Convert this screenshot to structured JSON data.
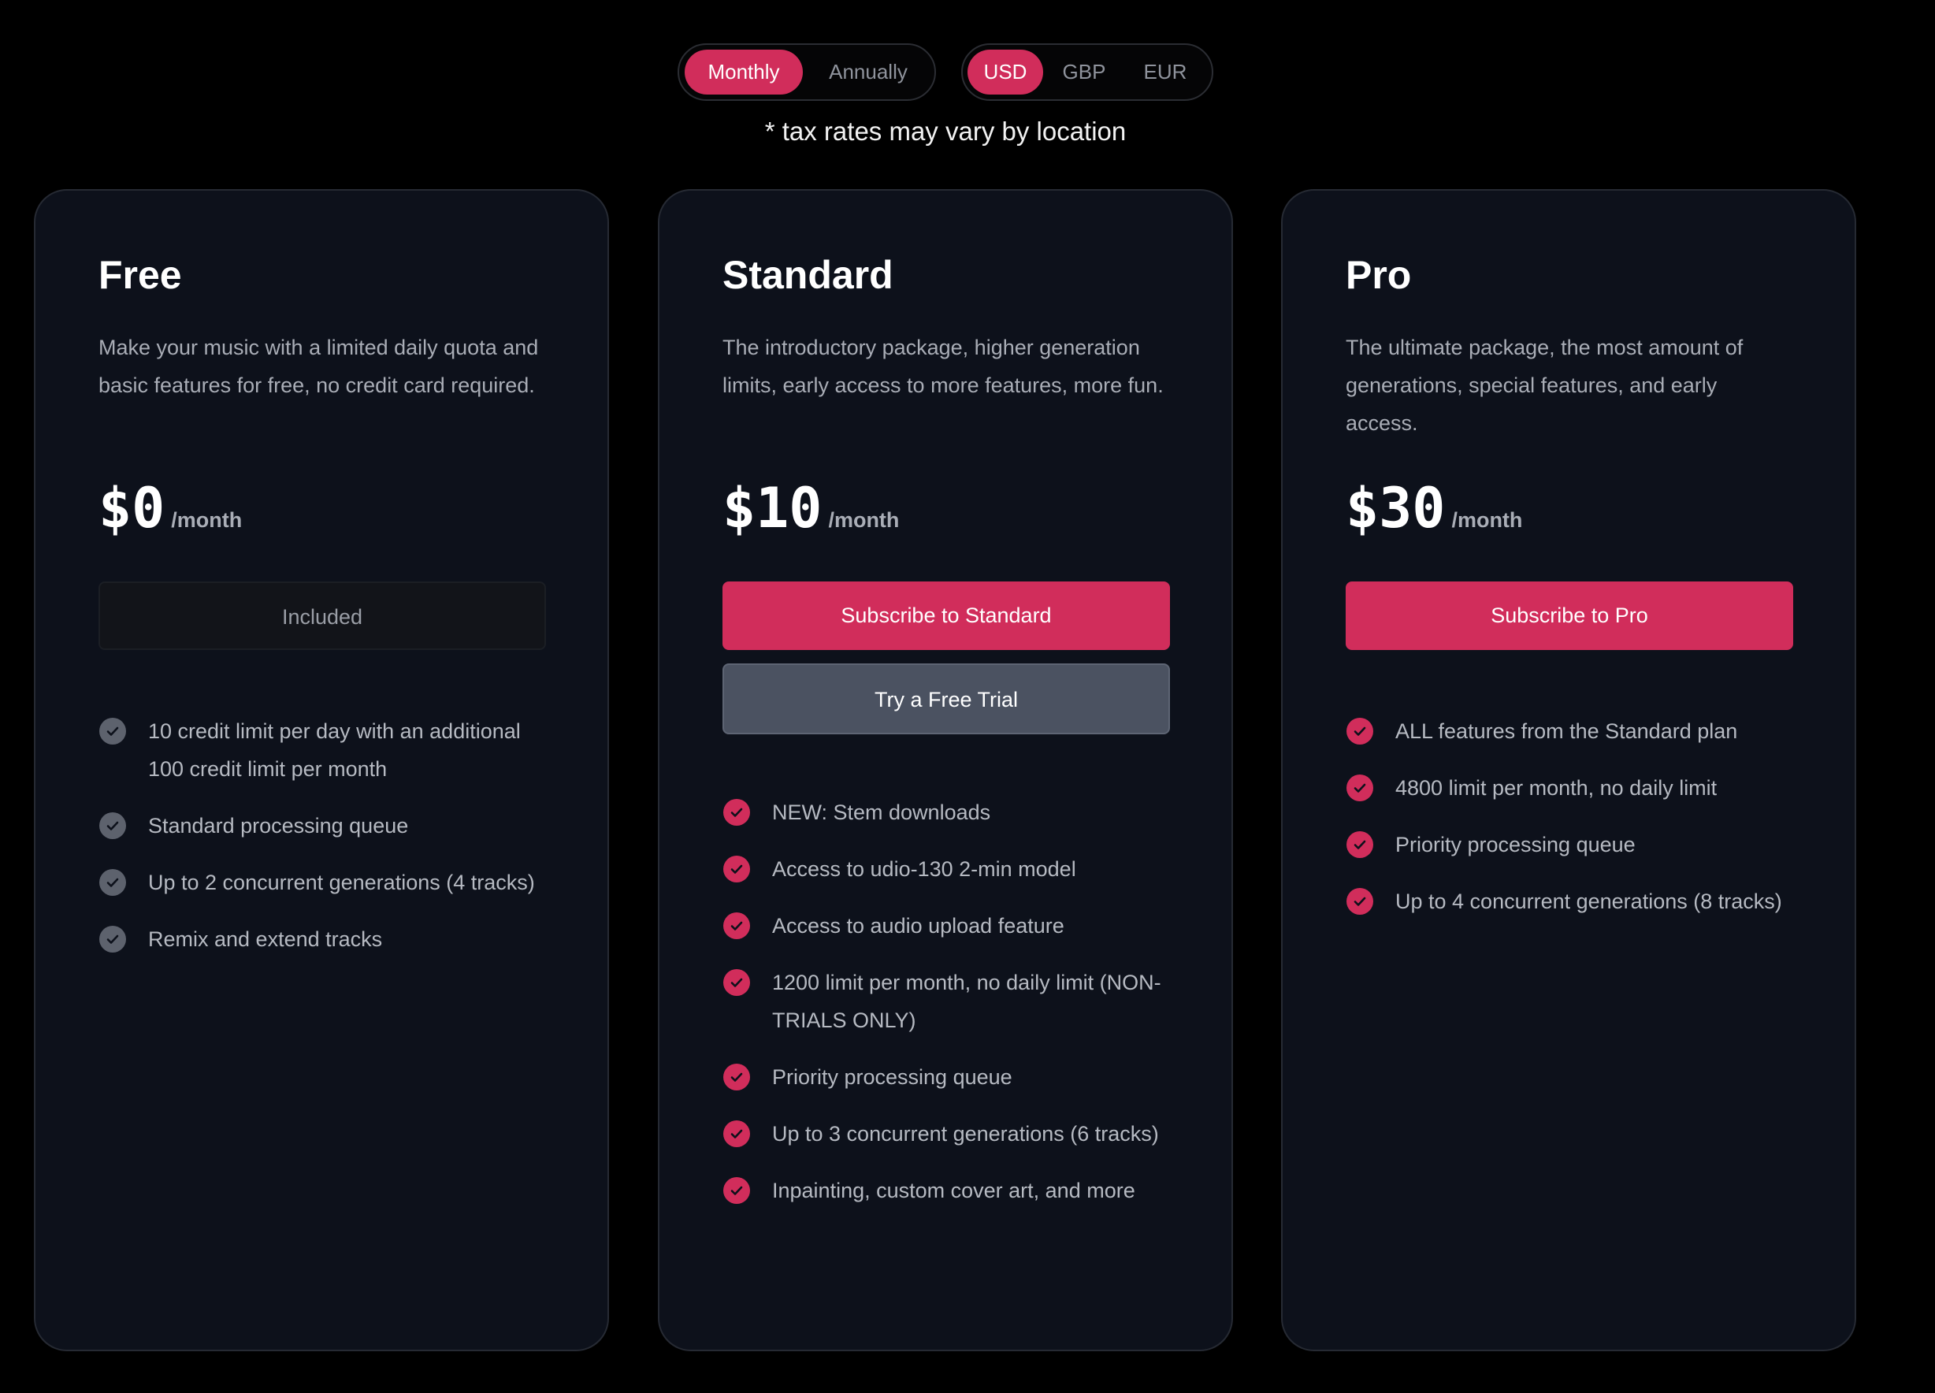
{
  "billing_toggle": {
    "options": [
      "Monthly",
      "Annually"
    ],
    "selected": "Monthly"
  },
  "currency_toggle": {
    "options": [
      "USD",
      "GBP",
      "EUR"
    ],
    "selected": "USD"
  },
  "tax_note": "* tax rates may vary by location",
  "colors": {
    "accent": "#d12d5b",
    "card_background": "#0d111b",
    "page_background": "#000000"
  },
  "plans": [
    {
      "name": "Free",
      "description": "Make your music with a limited daily quota and basic features for free, no credit card required.",
      "price": "$0",
      "period": "/month",
      "included_label": "Included",
      "features": [
        "10 credit limit per day with an additional 100 credit limit per month",
        "Standard processing queue",
        "Up to 2 concurrent generations (4 tracks)",
        "Remix and extend tracks"
      ]
    },
    {
      "name": "Standard",
      "description": "The introductory package, higher generation limits, early access to more features, more fun.",
      "price": "$10",
      "period": "/month",
      "subscribe_label": "Subscribe to Standard",
      "trial_label": "Try a Free Trial",
      "features": [
        "NEW: Stem downloads",
        "Access to udio-130 2-min model",
        "Access to audio upload feature",
        "1200 limit per month, no daily limit (NON-TRIALS ONLY)",
        "Priority processing queue",
        "Up to 3 concurrent generations (6 tracks)",
        "Inpainting, custom cover art, and more"
      ]
    },
    {
      "name": "Pro",
      "description": "The ultimate package, the most amount of generations, special features, and early access.",
      "price": "$30",
      "period": "/month",
      "subscribe_label": "Subscribe to Pro",
      "features": [
        "ALL features from the Standard plan",
        "4800 limit per month, no daily limit",
        "Priority processing queue",
        "Up to 4 concurrent generations (8 tracks)"
      ]
    }
  ]
}
